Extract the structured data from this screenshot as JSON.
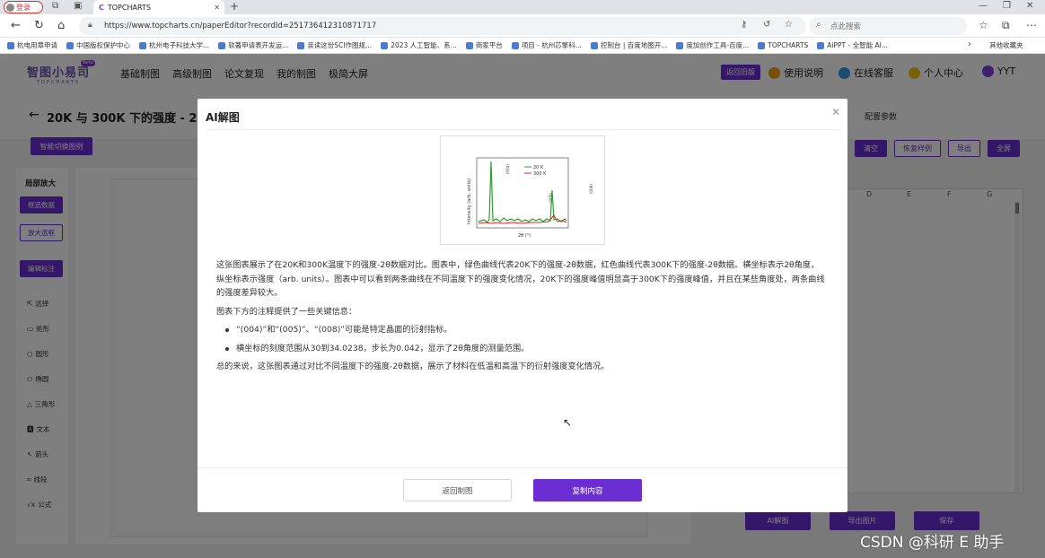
{
  "browser": {
    "profile_label": "登录",
    "tab_title": "TOPCHARTS",
    "url": "https://www.topcharts.cn/paperEditor?recordId=251736412310871717",
    "search_placeholder": "点此搜索",
    "bookmarks": [
      "杭电用章申请",
      "中国版权保护中心",
      "杭州电子科技大学...",
      "软著申请表开发运...",
      "亲读这份SCI作图规...",
      "2023 人工智能、系...",
      "商家平台",
      "项目 - 杭州芯擎科...",
      "控制台 | 百度地图开...",
      "度加创作工具-百度...",
      "TOPCHARTS",
      "AiPPT - 全智能 AI..."
    ],
    "bookmarks_other": "其他收藏夹"
  },
  "app": {
    "logo_text": "智图小易司",
    "logo_sub": "TOPCHARTS",
    "logo_badge": "Beta",
    "nav": [
      "基础制图",
      "高级制图",
      "论文复现",
      "我的制图",
      "极简大屏"
    ],
    "old_version": "返回旧版",
    "nav_right": [
      "使用说明",
      "在线客服",
      "个人中心",
      "YYT"
    ],
    "chart_title": "20K 与 300K 下的强度 - 2θ 对",
    "config_title": "配置参数",
    "smart_switch": "智能切换图例",
    "top_buttons": [
      "清空",
      "恢复样例",
      "导出",
      "全屏"
    ],
    "left_panel_title": "局部放大",
    "left_buttons": [
      "框选数据",
      "放大选框",
      "编辑标注"
    ],
    "tools": [
      "选择",
      "矩形",
      "圆形",
      "椭圆",
      "三角形",
      "文本",
      "箭头",
      "线段",
      "公式"
    ],
    "sheet_columns": [
      "D",
      "E",
      "F",
      "G"
    ],
    "bottom_buttons": [
      "AI解图",
      "导出图片",
      "保存"
    ]
  },
  "modal": {
    "title": "AI解图",
    "paragraph1": "这张图表展示了在20K和300K温度下的强度-2θ数据对比。图表中，绿色曲线代表20K下的强度-2θ数据，红色曲线代表300K下的强度-2θ数据。横坐标表示2θ角度，纵坐标表示强度（arb. units）。图表中可以看到两条曲线在不同温度下的强度变化情况，20K下的强度峰值明显高于300K下的强度峰值，并且在某些角度处，两条曲线的强度差异较大。",
    "paragraph2": "图表下方的注释提供了一些关键信息：",
    "bullets": [
      "“(004)”和“(005)”、“(008)”可能是特定晶面的衍射指标。",
      "横坐标的刻度范围从30到34.0238，步长为0.042，显示了2θ角度的测量范围。"
    ],
    "paragraph3": "总的来说，这张图表通过对比不同温度下的强度-2θ数据，展示了材料在低温和高温下的衍射强度变化情况。",
    "back_button": "返回制图",
    "copy_button": "复制内容",
    "thumbnail": {
      "ylabel": "Intensity (arb. units)",
      "xlabel": "2θ (°)",
      "legend": [
        "20 K",
        "300 K"
      ],
      "annotations": [
        "(004)",
        "(005)",
        "(008)"
      ],
      "colors": {
        "20K": "#2ca02c",
        "300K": "#d62728"
      }
    }
  },
  "watermark": "CSDN @科研 E 助手"
}
